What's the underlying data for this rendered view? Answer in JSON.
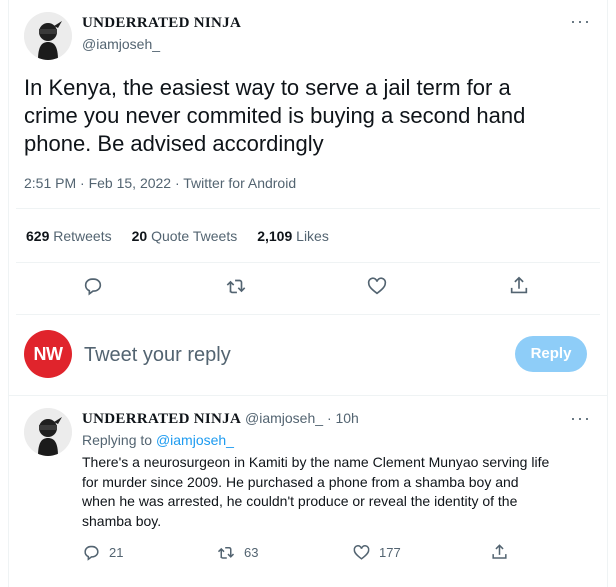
{
  "tweet": {
    "author_name": "UNDERRATED NINJA",
    "author_handle": "@iamjoseh_",
    "more": "···",
    "text_lines": [
      "In Kenya, the easiest way to serve a jail term for a",
      "crime you never commited is buying a second hand",
      "phone. Be advised accordingly"
    ],
    "meta": "2:51 PM · Feb 15, 2022 · Twitter for Android",
    "stats": {
      "retweets_count": "629",
      "retweets_label": "Retweets",
      "quote_count": "20",
      "quote_label": "Quote Tweets",
      "likes_count": "2,109",
      "likes_label": "Likes"
    },
    "actions": [
      "reply-icon",
      "retweet-icon",
      "like-icon",
      "share-icon"
    ]
  },
  "composer": {
    "avatar_text": "NW",
    "placeholder": "Tweet your reply",
    "reply_button": "Reply",
    "avatar_color": "#e0242c",
    "button_color": "#8ecdf8"
  },
  "reply": {
    "author_name": "UNDERRATED NINJA",
    "author_handle": "@iamjoseh_",
    "time": "· 10h",
    "more": "···",
    "replying_to_prefix": "Replying to",
    "replying_to_handle": "@iamjoseh_",
    "text_lines": [
      "There's a neurosurgeon in Kamiti by the name Clement Munyao serving life",
      "for murder since 2009. He purchased a phone from a shamba boy and",
      "when he was arrested, he couldn't produce or reveal the identity of the",
      "shamba boy."
    ],
    "replies_count": "21",
    "retweets_count": "63",
    "likes_count": "177"
  },
  "colors": {
    "text": "#0f1419",
    "secondary": "#536471",
    "accent": "#1d9bf0",
    "divider": "#eff3f4"
  }
}
